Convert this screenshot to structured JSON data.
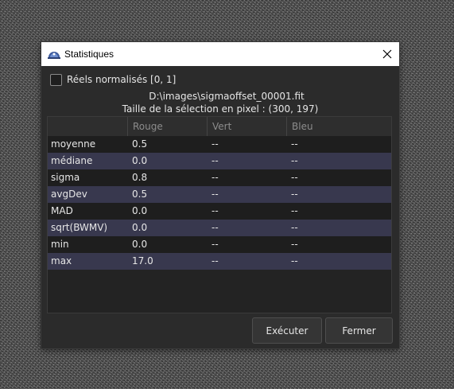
{
  "window": {
    "title": "Statistiques"
  },
  "options": {
    "normalized_label": "Réels normalisés [0, 1]",
    "normalized_checked": false
  },
  "info": {
    "file_path": "D:\\images\\sigmaoffset_00001.fit",
    "selection_size": "Taille de la sélection en pixel : (300, 197)"
  },
  "table": {
    "headers": [
      "",
      "Rouge",
      "Vert",
      "Bleu"
    ],
    "rows": [
      {
        "name": "moyenne",
        "rouge": "0.5",
        "vert": "--",
        "bleu": "--"
      },
      {
        "name": "médiane",
        "rouge": "0.0",
        "vert": "--",
        "bleu": "--"
      },
      {
        "name": "sigma",
        "rouge": "0.8",
        "vert": "--",
        "bleu": "--"
      },
      {
        "name": "avgDev",
        "rouge": "0.5",
        "vert": "--",
        "bleu": "--"
      },
      {
        "name": "MAD",
        "rouge": "0.0",
        "vert": "--",
        "bleu": "--"
      },
      {
        "name": "sqrt(BWMV)",
        "rouge": "0.0",
        "vert": "--",
        "bleu": "--"
      },
      {
        "name": "min",
        "rouge": "0.0",
        "vert": "--",
        "bleu": "--"
      },
      {
        "name": "max",
        "rouge": "17.0",
        "vert": "--",
        "bleu": "--"
      }
    ]
  },
  "buttons": {
    "run_label": "Exécuter",
    "close_label": "Fermer"
  },
  "icons": {
    "app": "siril-app-icon",
    "close": "close-icon"
  },
  "colors": {
    "dialog_bg": "#2b2b2b",
    "row_alt": "#38384e",
    "row_base": "#1e1e1e",
    "titlebar": "#ffffff"
  }
}
